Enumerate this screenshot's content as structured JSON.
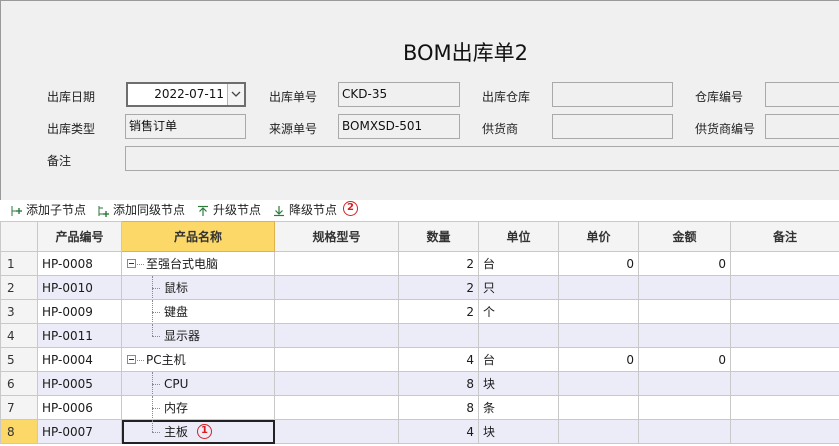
{
  "form": {
    "title": "BOM出库单2",
    "fields": {
      "out_date_label": "出库日期",
      "out_date_value": "2022-07-11",
      "out_no_label": "出库单号",
      "out_no_value": "CKD-35",
      "warehouse_label": "出库仓库",
      "warehouse_value": "",
      "warehouse_no_label": "仓库编号",
      "warehouse_no_value": "",
      "out_type_label": "出库类型",
      "out_type_value": "销售订单",
      "source_no_label": "来源单号",
      "source_no_value": "BOMXSD-501",
      "supplier_label": "供货商",
      "supplier_value": "",
      "supplier_no_label": "供货商编号",
      "supplier_no_value": "",
      "remark_label": "备注",
      "remark_value": ""
    }
  },
  "toolbar": {
    "add_child": "添加子节点",
    "add_sibling": "添加同级节点",
    "promote": "升级节点",
    "demote": "降级节点",
    "marker": "2",
    "icons": [
      "add-child-icon",
      "add-sibling-icon",
      "promote-icon",
      "demote-icon"
    ]
  },
  "grid": {
    "columns": [
      "产品编号",
      "产品名称",
      "规格型号",
      "数量",
      "单位",
      "单价",
      "金额",
      "备注"
    ],
    "active_column": "产品名称",
    "current_row": 8,
    "rows": [
      {
        "n": "1",
        "code": "HP-0008",
        "name": "至强台式电脑",
        "spec": "",
        "qty": "2",
        "unit": "台",
        "price": "0",
        "amount": "0",
        "remark": "",
        "level": 0,
        "expanded": true
      },
      {
        "n": "2",
        "code": "HP-0010",
        "name": "鼠标",
        "spec": "",
        "qty": "2",
        "unit": "只",
        "price": "",
        "amount": "",
        "remark": "",
        "level": 1
      },
      {
        "n": "3",
        "code": "HP-0009",
        "name": "键盘",
        "spec": "",
        "qty": "2",
        "unit": "个",
        "price": "",
        "amount": "",
        "remark": "",
        "level": 1
      },
      {
        "n": "4",
        "code": "HP-0011",
        "name": "显示器",
        "spec": "",
        "qty": "",
        "unit": "",
        "price": "",
        "amount": "",
        "remark": "",
        "level": 1
      },
      {
        "n": "5",
        "code": "HP-0004",
        "name": "PC主机",
        "spec": "",
        "qty": "4",
        "unit": "台",
        "price": "0",
        "amount": "0",
        "remark": "",
        "level": 0,
        "expanded": true
      },
      {
        "n": "6",
        "code": "HP-0005",
        "name": "CPU",
        "spec": "",
        "qty": "8",
        "unit": "块",
        "price": "",
        "amount": "",
        "remark": "",
        "level": 1
      },
      {
        "n": "7",
        "code": "HP-0006",
        "name": "内存",
        "spec": "",
        "qty": "8",
        "unit": "条",
        "price": "",
        "amount": "",
        "remark": "",
        "level": 1
      },
      {
        "n": "8",
        "code": "HP-0007",
        "name": "主板",
        "spec": "",
        "qty": "4",
        "unit": "块",
        "price": "",
        "amount": "",
        "remark": "",
        "level": 1,
        "marker": "1"
      }
    ]
  },
  "colors": {
    "active_header": "#fbd868",
    "alt_row": "#ececf8",
    "marker": "#d62020",
    "toolbar_icon": "#2a7a3a"
  }
}
